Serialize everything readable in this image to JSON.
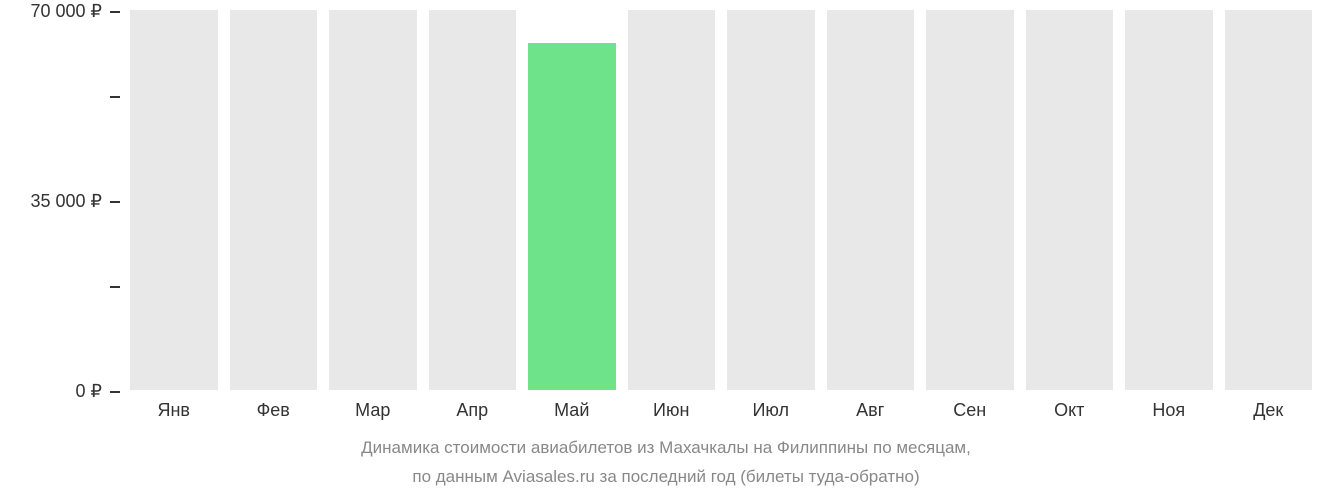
{
  "chart_data": {
    "type": "bar",
    "categories": [
      "Янв",
      "Фев",
      "Мар",
      "Апр",
      "Май",
      "Июн",
      "Июл",
      "Авг",
      "Сен",
      "Окт",
      "Ноя",
      "Дек"
    ],
    "values": [
      null,
      null,
      null,
      null,
      64000,
      null,
      null,
      null,
      null,
      null,
      null,
      null
    ],
    "y_ticks": [
      {
        "value": 70000,
        "label": "70 000 ₽"
      },
      {
        "value": 35000,
        "label": "35 000 ₽"
      },
      {
        "value": 0,
        "label": "0 ₽"
      }
    ],
    "y_minor_ticks": [
      52500,
      17500
    ],
    "ylim": [
      0,
      70000
    ],
    "ylabel": "",
    "xlabel": "",
    "title_line1": "Динамика стоимости авиабилетов из Махачкалы на Филиппины по месяцам,",
    "title_line2": "по данным Aviasales.ru за последний год (билеты туда-обратно)",
    "bar_color_data": "#6fe389",
    "bar_color_nodata": "#e8e8e8"
  }
}
